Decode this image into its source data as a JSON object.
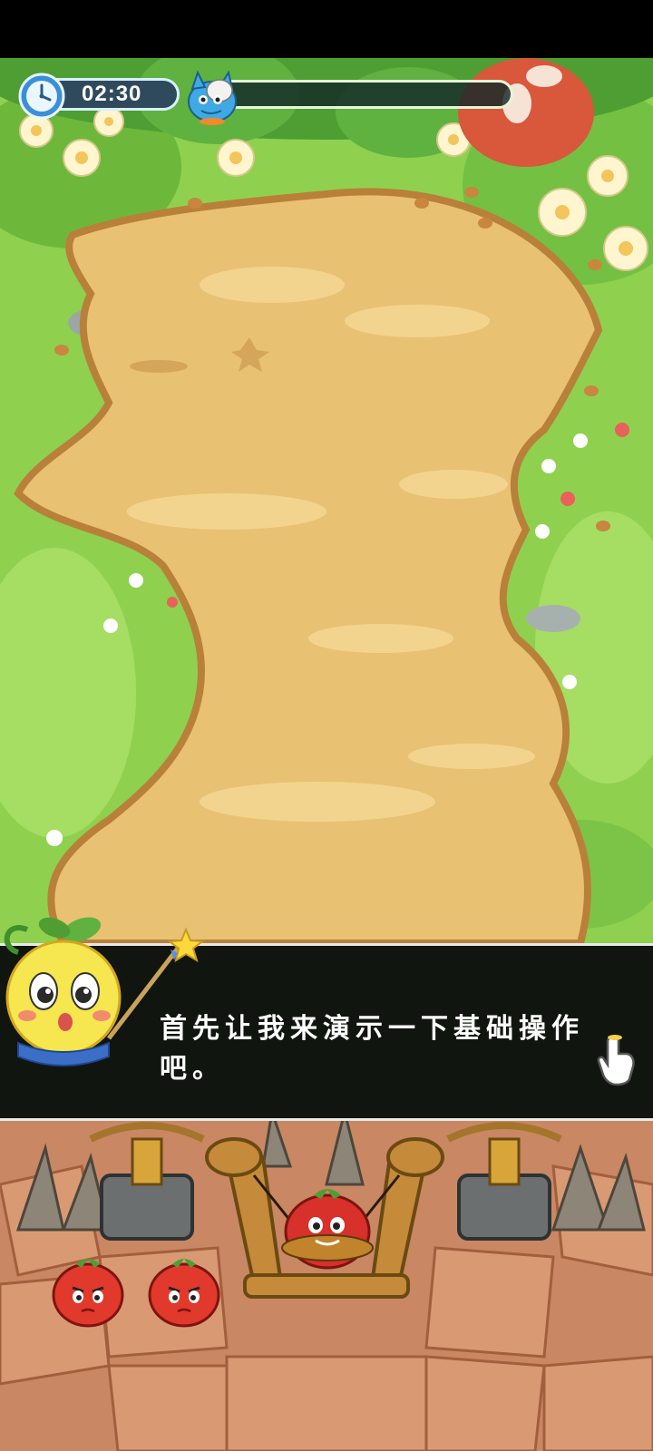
{
  "hud": {
    "timer_text": "02:30",
    "wave_progress": 0.0
  },
  "dialog": {
    "text": "首先让我来演示一下基础操作吧。"
  },
  "icons": {
    "timer": "clock-icon",
    "boss": "boss-avatar",
    "guide": "onion-guide-character",
    "hand": "tap-hand-icon"
  },
  "ammo": {
    "loaded": "angry-tomato",
    "queue": [
      "angry-tomato",
      "angry-tomato"
    ]
  },
  "colors": {
    "grass": "#8fd14f",
    "path": "#e9c173",
    "dialog_bg": "#101510",
    "base": "#c98763"
  }
}
